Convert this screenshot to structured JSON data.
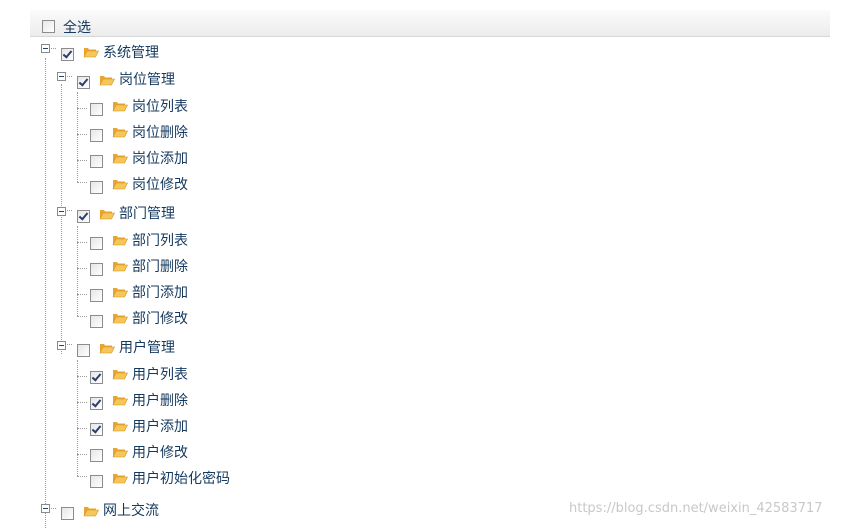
{
  "header": {
    "select_all_label": "全选",
    "select_all_checked": false
  },
  "tree": {
    "root1": {
      "label": "系统管理",
      "checked": true,
      "expanded": true,
      "icon": "folder-open-icon"
    },
    "post": {
      "label": "岗位管理",
      "checked": true,
      "expanded": true,
      "icon": "folder-open-icon",
      "children": [
        {
          "label": "岗位列表",
          "checked": false
        },
        {
          "label": "岗位删除",
          "checked": false
        },
        {
          "label": "岗位添加",
          "checked": false
        },
        {
          "label": "岗位修改",
          "checked": false
        }
      ]
    },
    "dept": {
      "label": "部门管理",
      "checked": true,
      "expanded": true,
      "icon": "folder-open-icon",
      "children": [
        {
          "label": "部门列表",
          "checked": false
        },
        {
          "label": "部门删除",
          "checked": false
        },
        {
          "label": "部门添加",
          "checked": false
        },
        {
          "label": "部门修改",
          "checked": false
        }
      ]
    },
    "user": {
      "label": "用户管理",
      "checked": false,
      "expanded": true,
      "icon": "folder-open-icon",
      "children": [
        {
          "label": "用户列表",
          "checked": true
        },
        {
          "label": "用户删除",
          "checked": true
        },
        {
          "label": "用户添加",
          "checked": true
        },
        {
          "label": "用户修改",
          "checked": false
        },
        {
          "label": "用户初始化密码",
          "checked": false
        }
      ]
    },
    "root2": {
      "label": "网上交流",
      "checked": false,
      "expanded": true,
      "icon": "folder-open-icon"
    }
  },
  "watermark": "https://blog.csdn.net/weixin_42583717",
  "colors": {
    "label": "#14395e",
    "folder": "#f0b33c",
    "connector": "#9a9a9a",
    "checkmark": "#2a3f6b"
  }
}
